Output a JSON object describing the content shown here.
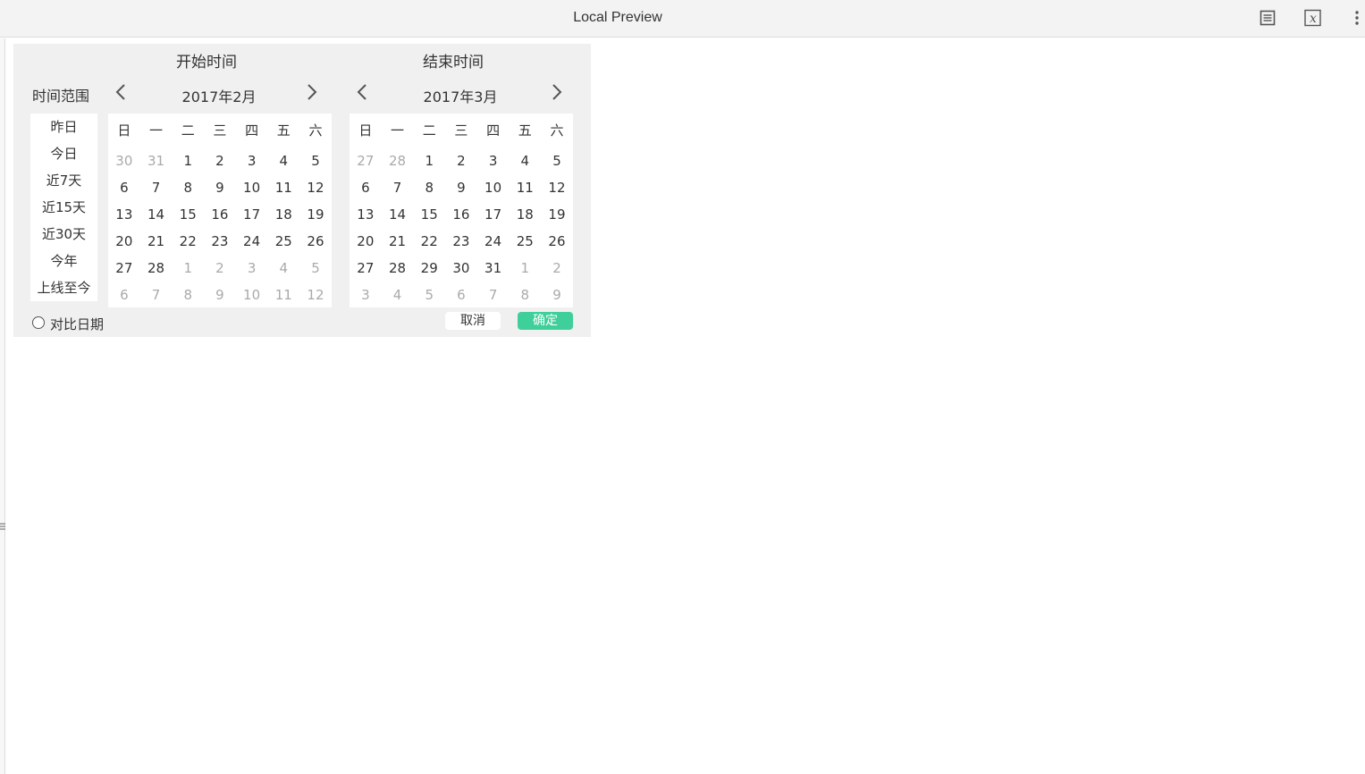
{
  "window": {
    "title": "Local Preview",
    "icons": [
      "document-icon",
      "formula-icon",
      "more-vertical-icon"
    ]
  },
  "picker": {
    "start_title": "开始时间",
    "end_title": "结束时间",
    "range_label": "时间范围",
    "quick_ranges": [
      "昨日",
      "今日",
      "近7天",
      "近15天",
      "近30天",
      "今年",
      "上线至今"
    ],
    "weekdays": [
      "日",
      "一",
      "二",
      "三",
      "四",
      "五",
      "六"
    ],
    "start_month": {
      "label": "2017年2月",
      "days": [
        [
          "30",
          "31",
          "1",
          "2",
          "3",
          "4",
          "5"
        ],
        [
          "6",
          "7",
          "8",
          "9",
          "10",
          "11",
          "12"
        ],
        [
          "13",
          "14",
          "15",
          "16",
          "17",
          "18",
          "19"
        ],
        [
          "20",
          "21",
          "22",
          "23",
          "24",
          "25",
          "26"
        ],
        [
          "27",
          "28",
          "1",
          "2",
          "3",
          "4",
          "5"
        ],
        [
          "6",
          "7",
          "8",
          "9",
          "10",
          "11",
          "12"
        ]
      ],
      "other": [
        [
          1,
          1,
          0,
          0,
          0,
          0,
          0
        ],
        [
          0,
          0,
          0,
          0,
          0,
          0,
          0
        ],
        [
          0,
          0,
          0,
          0,
          0,
          0,
          0
        ],
        [
          0,
          0,
          0,
          0,
          0,
          0,
          0
        ],
        [
          0,
          0,
          1,
          1,
          1,
          1,
          1
        ],
        [
          1,
          1,
          1,
          1,
          1,
          1,
          1
        ]
      ]
    },
    "end_month": {
      "label": "2017年3月",
      "days": [
        [
          "27",
          "28",
          "1",
          "2",
          "3",
          "4",
          "5"
        ],
        [
          "6",
          "7",
          "8",
          "9",
          "10",
          "11",
          "12"
        ],
        [
          "13",
          "14",
          "15",
          "16",
          "17",
          "18",
          "19"
        ],
        [
          "20",
          "21",
          "22",
          "23",
          "24",
          "25",
          "26"
        ],
        [
          "27",
          "28",
          "29",
          "30",
          "31",
          "1",
          "2"
        ],
        [
          "3",
          "4",
          "5",
          "6",
          "7",
          "8",
          "9"
        ]
      ],
      "other": [
        [
          1,
          1,
          0,
          0,
          0,
          0,
          0
        ],
        [
          0,
          0,
          0,
          0,
          0,
          0,
          0
        ],
        [
          0,
          0,
          0,
          0,
          0,
          0,
          0
        ],
        [
          0,
          0,
          0,
          0,
          0,
          0,
          0
        ],
        [
          0,
          0,
          0,
          0,
          0,
          1,
          1
        ],
        [
          1,
          1,
          1,
          1,
          1,
          1,
          1
        ]
      ]
    },
    "compare_label": "对比日期",
    "cancel_label": "取消",
    "ok_label": "确定",
    "colors": {
      "accent": "#3ecf9a",
      "panel_bg": "#f0f0f0",
      "muted_day": "#aaaaaa"
    }
  }
}
